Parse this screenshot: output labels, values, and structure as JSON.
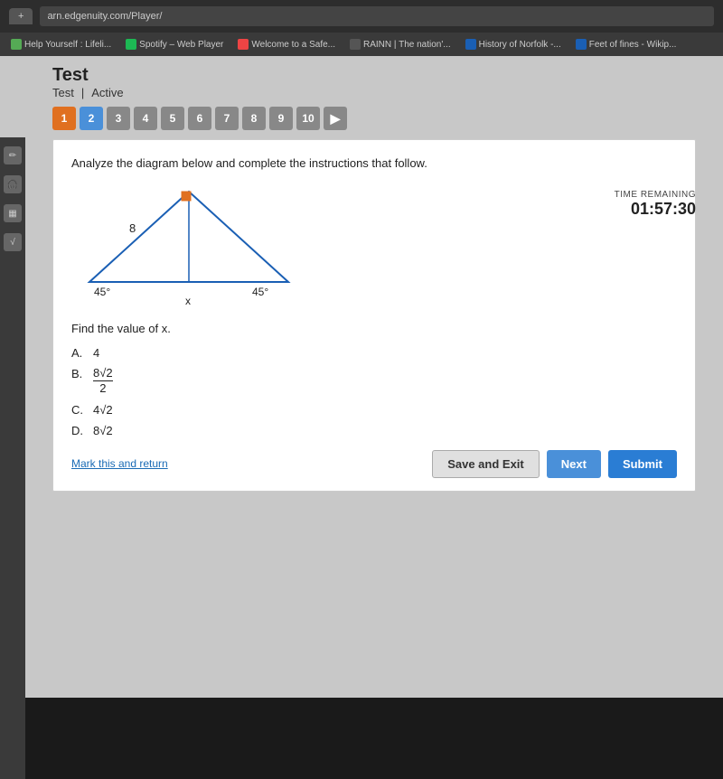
{
  "browser": {
    "tab_label": "+",
    "url": "arn.edgenuity.com/Player/",
    "bookmarks": [
      {
        "label": "Help Yourself : Lifeli...",
        "icon_color": "#5a5"
      },
      {
        "label": "Spotify – Web Player",
        "icon_color": "#1db954"
      },
      {
        "label": "Welcome to a Safe...",
        "icon_color": "#e44"
      },
      {
        "label": "RAINN | The nation'...",
        "icon_color": "#555"
      },
      {
        "label": "History of Norfolk -...",
        "icon_color": "#1a5fb4"
      },
      {
        "label": "Feet of fines - Wikip...",
        "icon_color": "#1a5fb4"
      }
    ]
  },
  "test": {
    "title": "Test",
    "subtitle": "Test",
    "status": "Active",
    "timer_label": "TIME REMAINING",
    "timer_value": "01:57:30",
    "question_numbers": [
      "1",
      "2",
      "3",
      "4",
      "5",
      "6",
      "7",
      "8",
      "9",
      "10"
    ]
  },
  "question": {
    "instructions": "Analyze the diagram below and complete the instructions that follow.",
    "find_text": "Find the value of x.",
    "answers": [
      {
        "label": "A.",
        "text": "4",
        "type": "plain"
      },
      {
        "label": "B.",
        "numerator": "8√2",
        "denominator": "2",
        "type": "fraction"
      },
      {
        "label": "C.",
        "text": "4√2",
        "type": "sqrt"
      },
      {
        "label": "D.",
        "text": "8√2",
        "type": "sqrt"
      }
    ]
  },
  "buttons": {
    "save_exit": "Save and Exit",
    "next": "Next",
    "submit": "Submit",
    "mark_return": "Mark this and return"
  },
  "sidebar_icons": [
    "pencil",
    "headphone",
    "calculator",
    "sqrt"
  ]
}
